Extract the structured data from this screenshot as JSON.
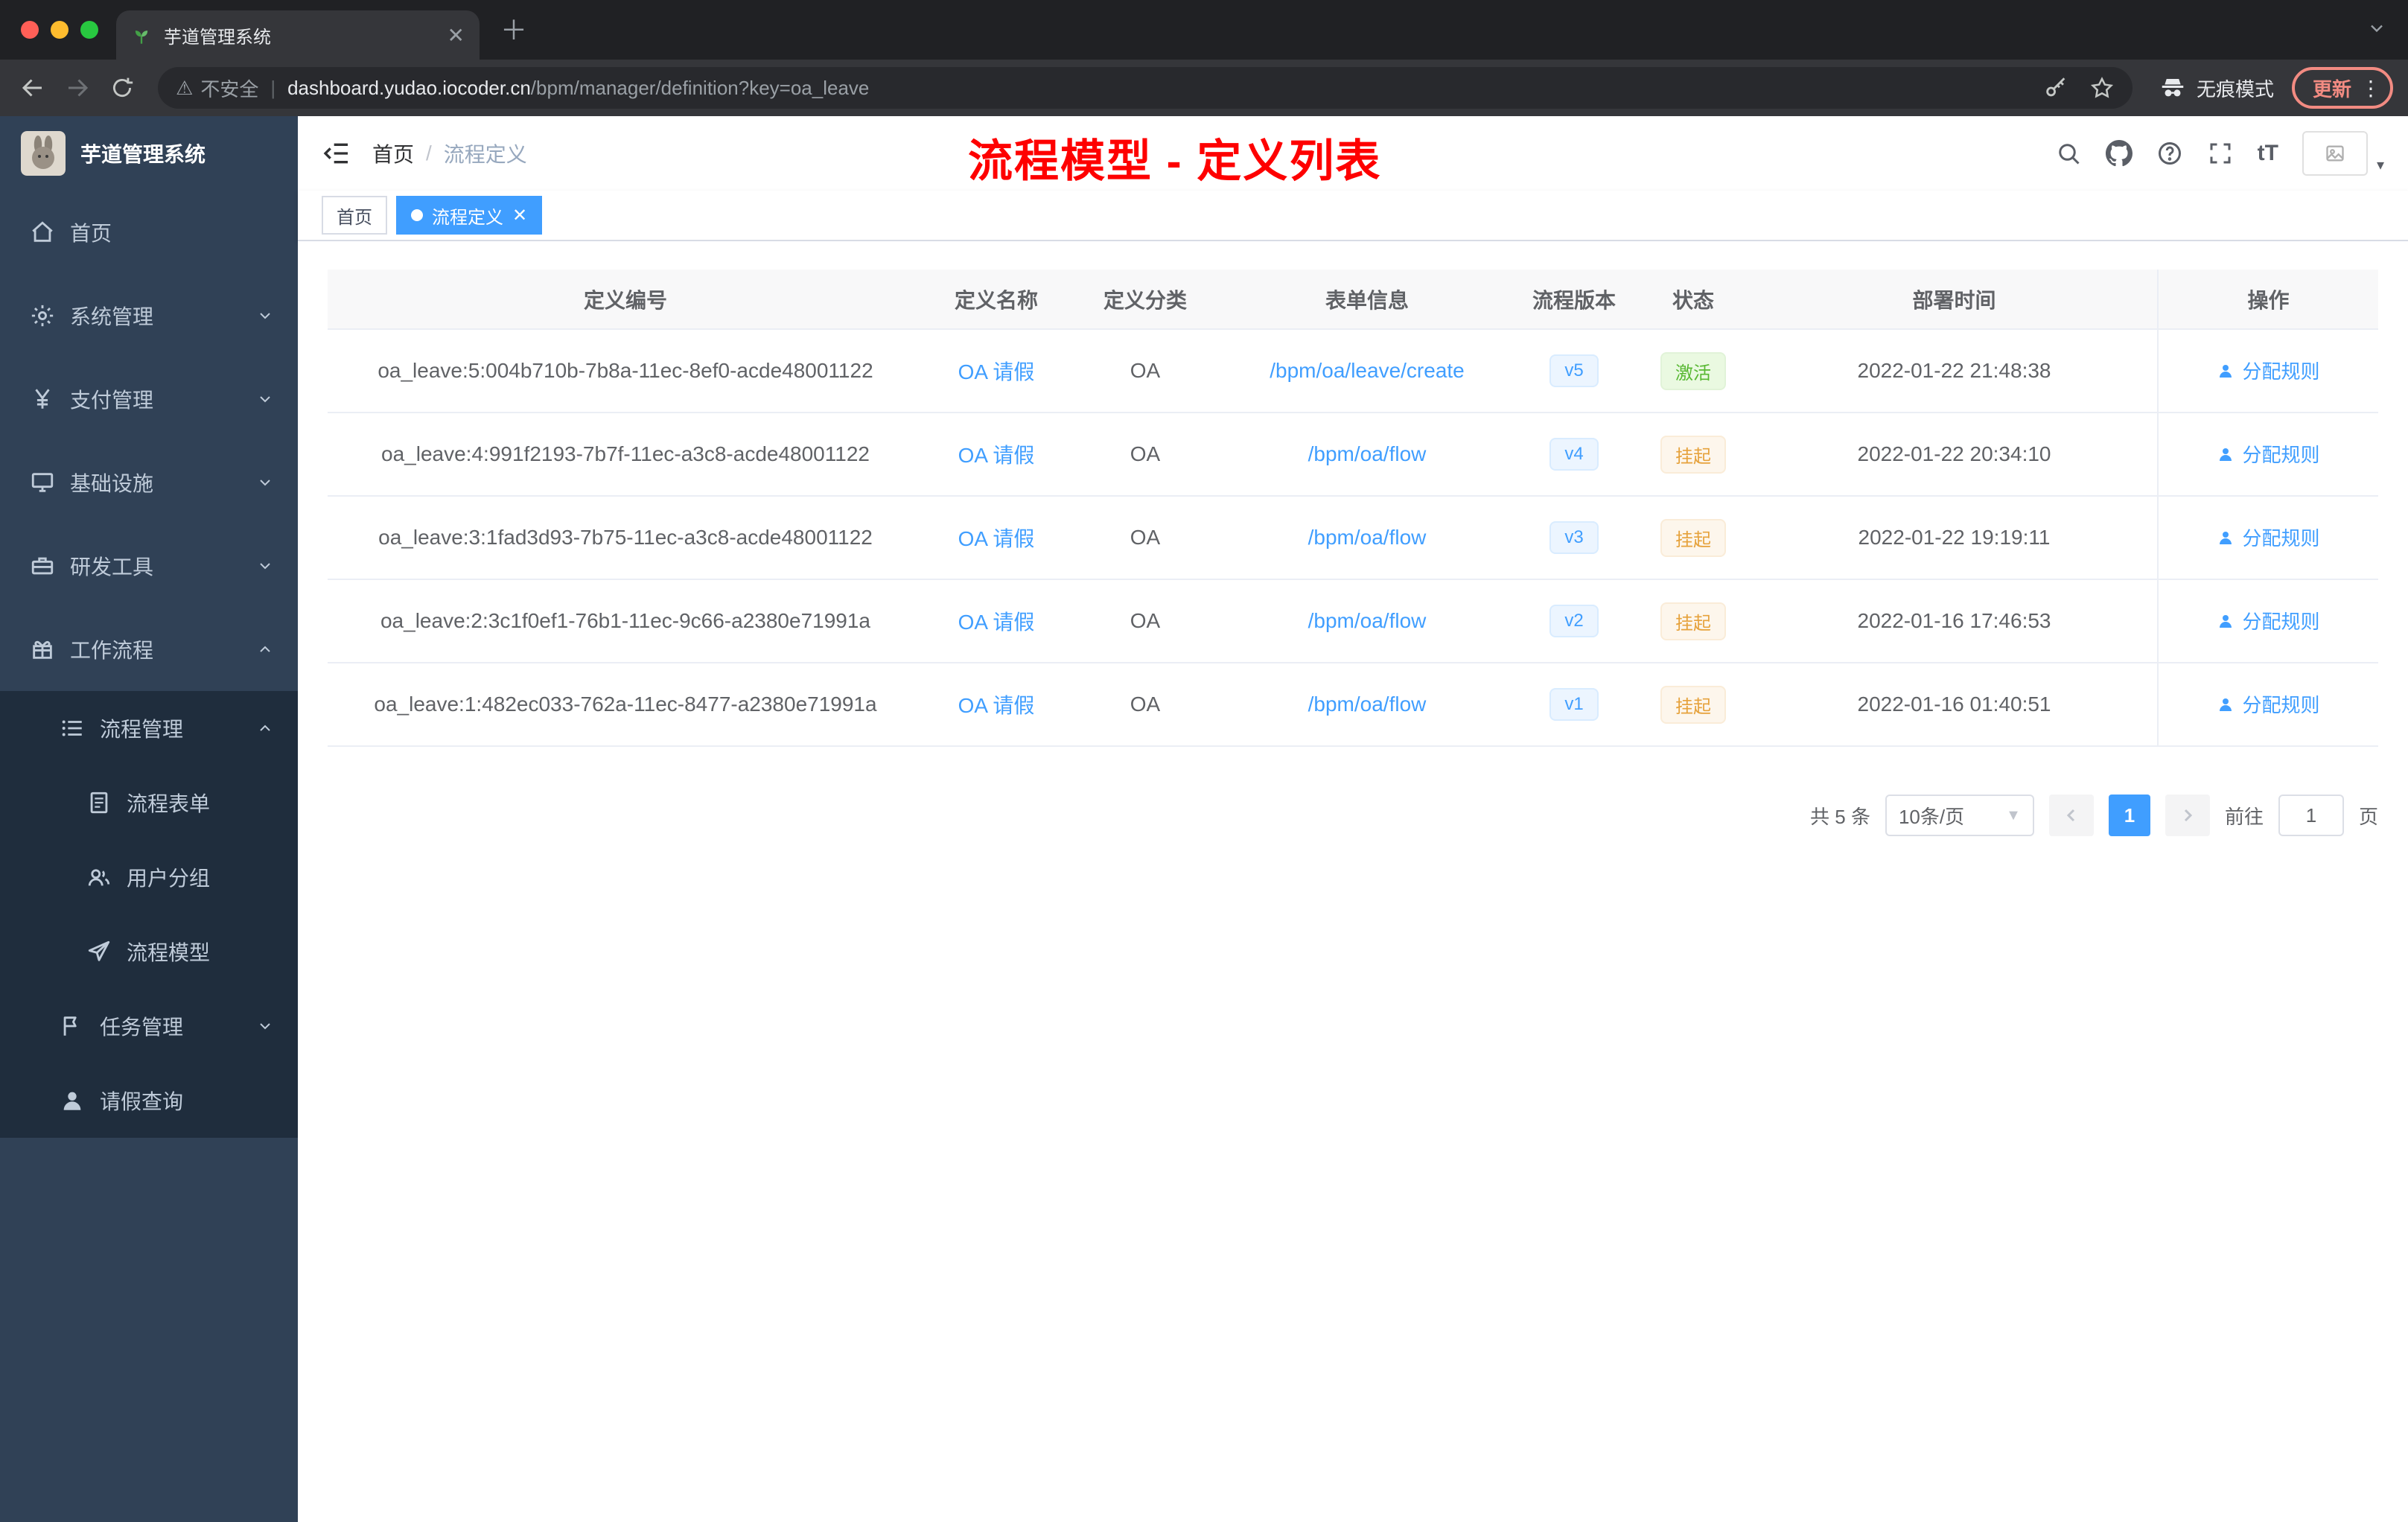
{
  "browser": {
    "tab_title": "芋道管理系统",
    "security_warning": "不安全",
    "url_host": "dashboard.yudao.iocoder.cn",
    "url_path": "/bpm/manager/definition?key=oa_leave",
    "incognito_label": "无痕模式",
    "update_label": "更新"
  },
  "sidebar": {
    "app_title": "芋道管理系统",
    "items": [
      {
        "label": "首页"
      },
      {
        "label": "系统管理"
      },
      {
        "label": "支付管理"
      },
      {
        "label": "基础设施"
      },
      {
        "label": "研发工具"
      },
      {
        "label": "工作流程"
      },
      {
        "label": "流程管理"
      },
      {
        "label": "流程表单"
      },
      {
        "label": "用户分组"
      },
      {
        "label": "流程模型"
      },
      {
        "label": "任务管理"
      },
      {
        "label": "请假查询"
      }
    ]
  },
  "header": {
    "breadcrumb_home": "首页",
    "breadcrumb_separator": "/",
    "breadcrumb_current": "流程定义",
    "annotation": "流程模型 - 定义列表"
  },
  "tags": {
    "home": "首页",
    "active": "流程定义"
  },
  "table": {
    "columns": [
      "定义编号",
      "定义名称",
      "定义分类",
      "表单信息",
      "流程版本",
      "状态",
      "部署时间",
      "操作"
    ],
    "rows": [
      {
        "id": "oa_leave:5:004b710b-7b8a-11ec-8ef0-acde48001122",
        "name": "OA 请假",
        "category": "OA",
        "form": "/bpm/oa/leave/create",
        "version": "v5",
        "status": "激活",
        "time": "2022-01-22 21:48:38",
        "action": "分配规则"
      },
      {
        "id": "oa_leave:4:991f2193-7b7f-11ec-a3c8-acde48001122",
        "name": "OA 请假",
        "category": "OA",
        "form": "/bpm/oa/flow",
        "version": "v4",
        "status": "挂起",
        "time": "2022-01-22 20:34:10",
        "action": "分配规则"
      },
      {
        "id": "oa_leave:3:1fad3d93-7b75-11ec-a3c8-acde48001122",
        "name": "OA 请假",
        "category": "OA",
        "form": "/bpm/oa/flow",
        "version": "v3",
        "status": "挂起",
        "time": "2022-01-22 19:19:11",
        "action": "分配规则"
      },
      {
        "id": "oa_leave:2:3c1f0ef1-76b1-11ec-9c66-a2380e71991a",
        "name": "OA 请假",
        "category": "OA",
        "form": "/bpm/oa/flow",
        "version": "v2",
        "status": "挂起",
        "time": "2022-01-16 17:46:53",
        "action": "分配规则"
      },
      {
        "id": "oa_leave:1:482ec033-762a-11ec-8477-a2380e71991a",
        "name": "OA 请假",
        "category": "OA",
        "form": "/bpm/oa/flow",
        "version": "v1",
        "status": "挂起",
        "time": "2022-01-16 01:40:51",
        "action": "分配规则"
      }
    ]
  },
  "pagination": {
    "total": "共 5 条",
    "page_size": "10条/页",
    "current_page": "1",
    "goto_label": "前往",
    "goto_value": "1",
    "page_unit": "页"
  },
  "colors": {
    "accent_blue": "#409eff",
    "success_green": "#67c23a",
    "warning_orange": "#e6a23c",
    "annotation_red": "#fe0000",
    "sidebar_bg": "#304156",
    "submenu_bg": "#1f2d3d"
  }
}
